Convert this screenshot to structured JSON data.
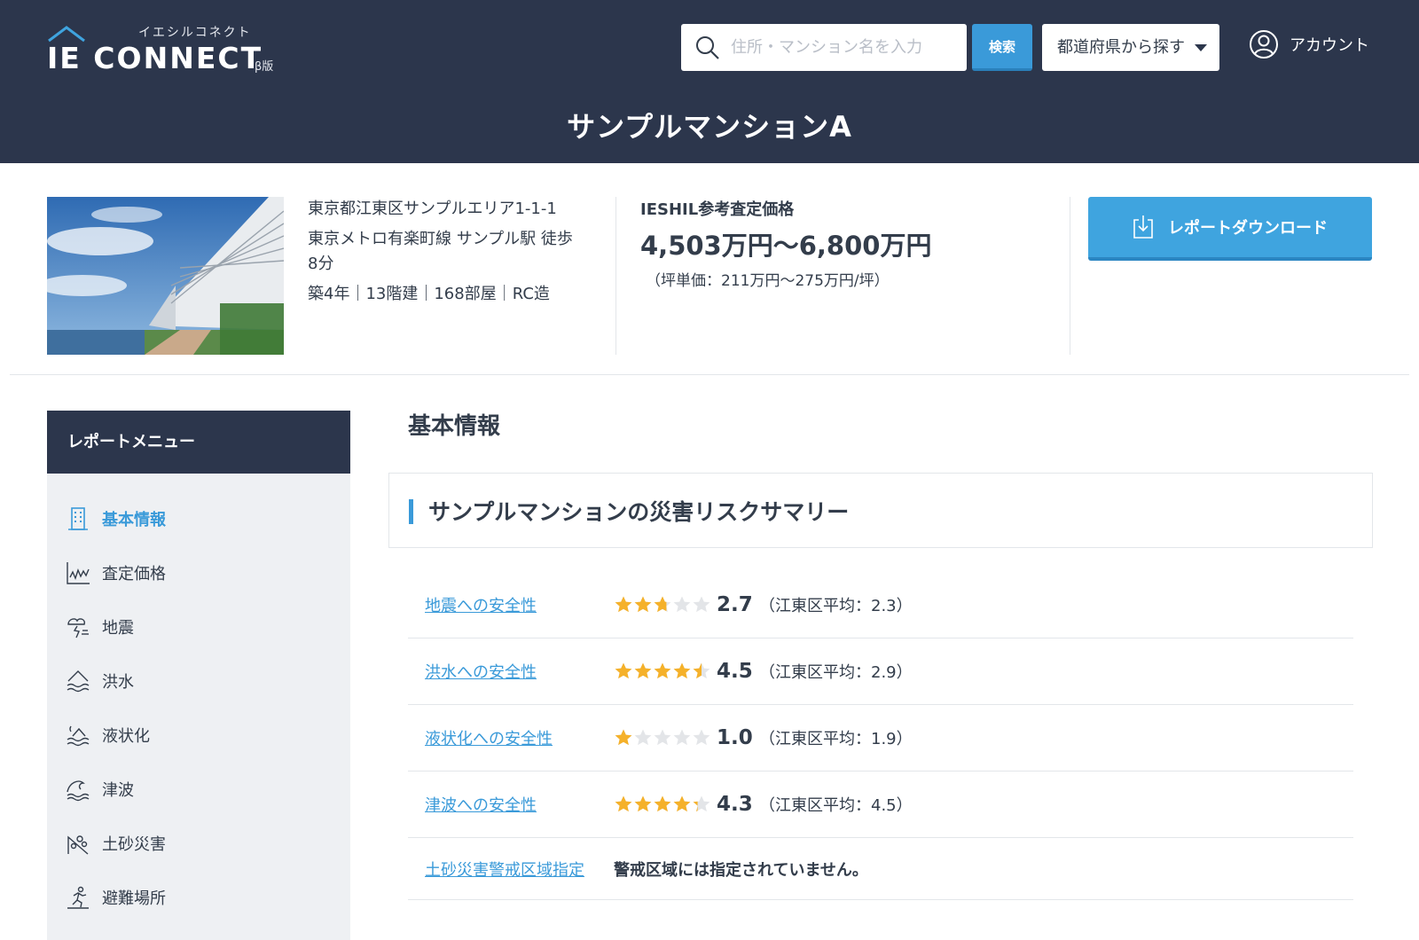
{
  "header": {
    "logo_kana": "イエシルコネクト",
    "logo_word": "IE CONNECT",
    "logo_beta": "β版",
    "search_placeholder": "住所・マンション名を入力",
    "search_button": "検索",
    "pref_select": "都道府県から探す",
    "account_label": "アカウント",
    "page_title": "サンプルマンションA"
  },
  "property": {
    "address": "東京都江東区サンプルエリア1-1-1",
    "access": "東京メトロ有楽町線 サンプル駅 徒歩8分",
    "specs": "築4年｜13階建｜168部屋｜RC造",
    "price_label": "IESHIL参考査定価格",
    "price_range": "4,503万円〜6,800万円",
    "price_tsubo": "（坪単価：211万円〜275万円/坪）",
    "download_label": "レポートダウンロード"
  },
  "sidebar": {
    "title": "レポートメニュー",
    "items": [
      {
        "label": "基本情報",
        "icon": "building-icon",
        "active": true
      },
      {
        "label": "査定価格",
        "icon": "chart-icon",
        "active": false
      },
      {
        "label": "地震",
        "icon": "earthquake-icon",
        "active": false
      },
      {
        "label": "洪水",
        "icon": "flood-icon",
        "active": false
      },
      {
        "label": "液状化",
        "icon": "liquefaction-icon",
        "active": false
      },
      {
        "label": "津波",
        "icon": "tsunami-icon",
        "active": false
      },
      {
        "label": "土砂災害",
        "icon": "landslide-icon",
        "active": false
      },
      {
        "label": "避難場所",
        "icon": "evacuation-icon",
        "active": false
      }
    ]
  },
  "main": {
    "section_title": "基本情報",
    "card_title": "サンプルマンションの災害リスクサマリー",
    "risks": [
      {
        "label": "地震への安全性",
        "rating": 2.7,
        "score": "2.7",
        "avg": "（江東区平均：2.3）"
      },
      {
        "label": "洪水への安全性",
        "rating": 4.5,
        "score": "4.5",
        "avg": "（江東区平均：2.9）"
      },
      {
        "label": "液状化への安全性",
        "rating": 1.0,
        "score": "1.0",
        "avg": "（江東区平均：1.9）"
      },
      {
        "label": "津波への安全性",
        "rating": 4.3,
        "score": "4.3",
        "avg": "（江東区平均：4.5）"
      }
    ],
    "landslide_label": "土砂災害警戒区域指定",
    "landslide_notice": "警戒区域には指定されていません。"
  },
  "colors": {
    "header_bg": "#2c364c",
    "accent_blue": "#3a9ad9",
    "star_on": "#f5b12a",
    "star_off": "#e3e5e8",
    "sidebar_bg": "#eef0f3"
  }
}
